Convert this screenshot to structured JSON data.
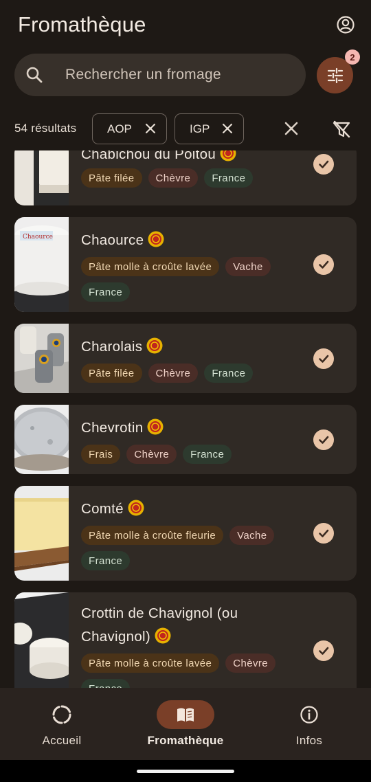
{
  "app": {
    "title": "Fromathèque"
  },
  "search": {
    "placeholder": "Rechercher un fromage",
    "value": ""
  },
  "filters": {
    "badge_count": "2",
    "results_label": "54 résultats",
    "chips": [
      {
        "label": "AOP"
      },
      {
        "label": "IGP"
      }
    ]
  },
  "cheeses": [
    {
      "name": "Chabichou du Poitou",
      "label": "AOP",
      "tags": [
        {
          "text": "Pâte filée",
          "kind": "texture"
        },
        {
          "text": "Chèvre",
          "kind": "milk"
        },
        {
          "text": "France",
          "kind": "country"
        }
      ],
      "checked": true
    },
    {
      "name": "Chaource",
      "label": "AOP",
      "tags": [
        {
          "text": "Pâte molle à croûte lavée",
          "kind": "texture"
        },
        {
          "text": "Vache",
          "kind": "milk"
        },
        {
          "text": "France",
          "kind": "country"
        }
      ],
      "checked": true
    },
    {
      "name": "Charolais",
      "label": "AOP",
      "tags": [
        {
          "text": "Pâte filée",
          "kind": "texture"
        },
        {
          "text": "Chèvre",
          "kind": "milk"
        },
        {
          "text": "France",
          "kind": "country"
        }
      ],
      "checked": true
    },
    {
      "name": "Chevrotin",
      "label": "AOP",
      "tags": [
        {
          "text": "Frais",
          "kind": "texture"
        },
        {
          "text": "Chèvre",
          "kind": "milk"
        },
        {
          "text": "France",
          "kind": "country"
        }
      ],
      "checked": true
    },
    {
      "name": "Comté",
      "label": "AOP",
      "tags": [
        {
          "text": "Pâte molle à croûte fleurie",
          "kind": "texture"
        },
        {
          "text": "Vache",
          "kind": "milk"
        },
        {
          "text": "France",
          "kind": "country"
        }
      ],
      "checked": true
    },
    {
      "name": "Crottin de Chavignol (ou Chavignol)",
      "label": "AOP",
      "tags": [
        {
          "text": "Pâte molle à croûte lavée",
          "kind": "texture"
        },
        {
          "text": "Chèvre",
          "kind": "milk"
        },
        {
          "text": "France",
          "kind": "country"
        }
      ],
      "checked": true
    }
  ],
  "nav": {
    "items": [
      {
        "label": "Accueil",
        "icon": "loader-icon",
        "active": false
      },
      {
        "label": "Fromathèque",
        "icon": "book-icon",
        "active": true
      },
      {
        "label": "Infos",
        "icon": "info-icon",
        "active": false
      }
    ]
  },
  "colors": {
    "background": "#1e1915",
    "accent": "#7a3f28",
    "check": "#e9c5a8"
  }
}
